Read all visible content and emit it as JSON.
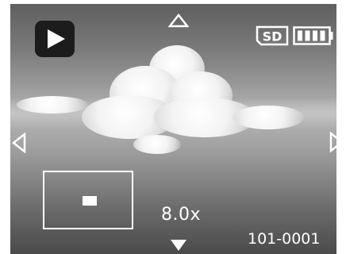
{
  "playback": {
    "mode_icon": "play-icon",
    "zoom_label": "8.0x",
    "file_number": "101-0001"
  },
  "status": {
    "storage_icon": "sd-card-icon",
    "storage_label": "SD",
    "battery_icon": "battery-full-icon",
    "battery_level": 1.0
  },
  "navigation": {
    "up_icon": "arrow-up-icon",
    "down_icon": "arrow-down-icon",
    "left_icon": "arrow-left-icon",
    "right_icon": "arrow-right-icon"
  },
  "zoom_navigator": {
    "frame_icon": "zoom-position-frame",
    "indicator_icon": "zoom-viewport-indicator"
  },
  "colors": {
    "overlay": "#ffffff",
    "badge": "#1c1c1c"
  }
}
